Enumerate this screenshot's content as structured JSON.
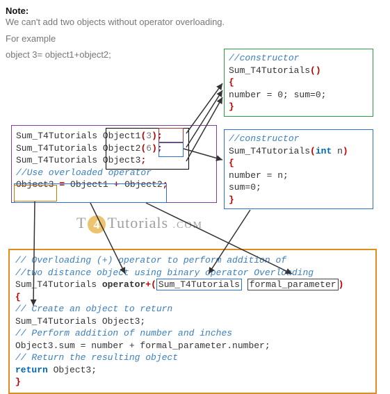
{
  "note": {
    "title": "Note:",
    "line1": "We can't add two objects without operator overloading.",
    "line2": "For example",
    "line3": "object 3= object1+object2;"
  },
  "ctor1": {
    "comment": "//constructor",
    "name": "Sum_T4Tutorials",
    "body": "number = 0; sum=0;"
  },
  "ctor2": {
    "comment": "//constructor",
    "name": "Sum_T4Tutorials",
    "param_type": "int",
    "param_name": "n",
    "body1": "number = n;",
    "body2": "sum=0;"
  },
  "decls": {
    "type": "Sum_T4Tutorials",
    "d1_name": "Object1",
    "d1_arg": "3",
    "d2_name": "Object2",
    "d2_arg": "6",
    "d3_name": "Object3",
    "comment": "//Use overloaded operator",
    "assign_lhs": "Object3",
    "assign_r1": "Object1",
    "assign_r2": "Object2"
  },
  "op": {
    "c1": "// Overloading (+) operator to perform addition of",
    "c2": "//two distance object using binary operator Overloading",
    "ret_type": "Sum_T4Tutorials",
    "kw_operator": "operator",
    "plus": "+",
    "param_type": "Sum_T4Tutorials",
    "param_name": "formal_parameter",
    "c3": "// Create an object to return",
    "local": "Sum_T4Tutorials Object3;",
    "c4": "// Perform addition of number and inches",
    "sum_line": "Object3.sum = number + formal_parameter.number;",
    "c5": "// Return the resulting object",
    "ret_kw": "return",
    "ret_val": "Object3;"
  },
  "watermark": {
    "t": "T",
    "four": "4",
    "rest": "Tutorials",
    "dom": ".COM"
  }
}
